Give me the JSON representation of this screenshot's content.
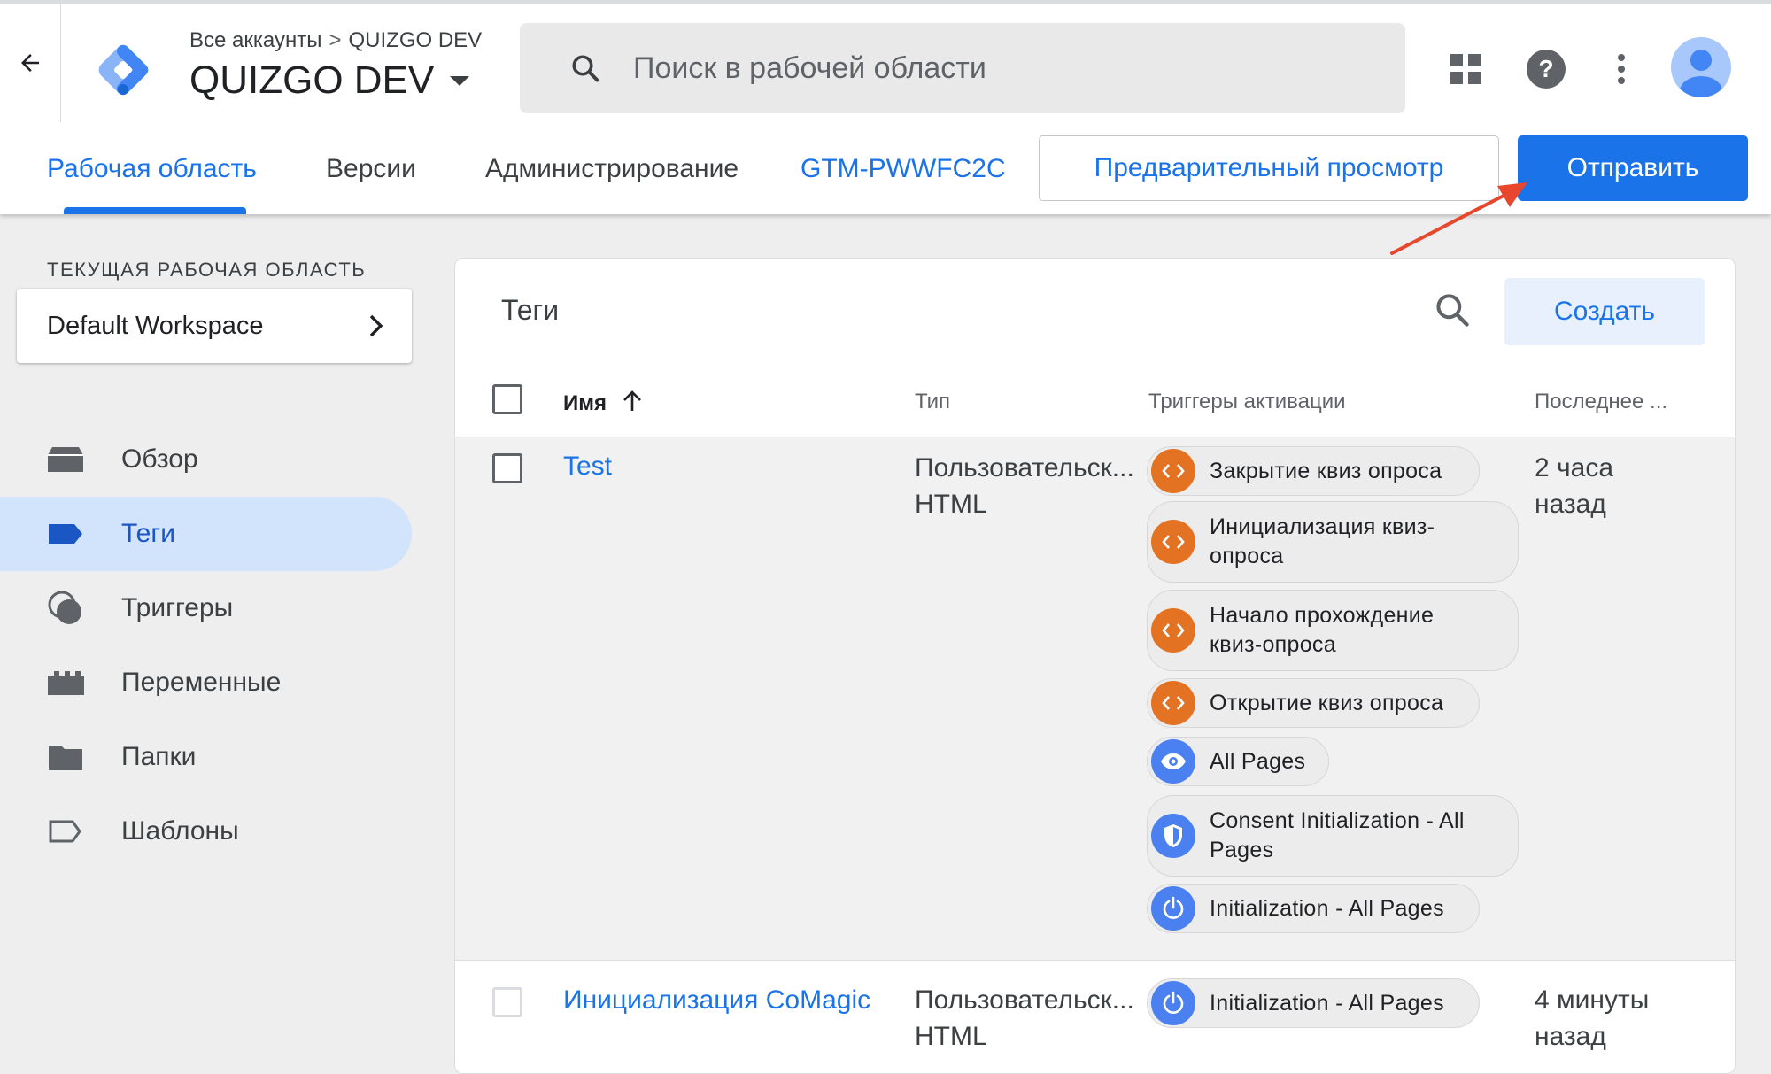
{
  "header": {
    "breadcrumb": {
      "accounts": "Все аккаунты",
      "container": "QUIZGO DEV"
    },
    "container_name": "QUIZGO DEV",
    "search_placeholder": "Поиск в рабочей области"
  },
  "nav": {
    "tabs": [
      {
        "label": "Рабочая область",
        "active": true
      },
      {
        "label": "Версии"
      },
      {
        "label": "Администрирование"
      }
    ],
    "container_id": "GTM-PWWFC2C",
    "preview_label": "Предварительный просмотр",
    "submit_label": "Отправить"
  },
  "sidebar": {
    "workspace_caption": "ТЕКУЩАЯ РАБОЧАЯ ОБЛАСТЬ",
    "workspace_name": "Default Workspace",
    "items": [
      {
        "label": "Обзор",
        "icon": "overview-icon"
      },
      {
        "label": "Теги",
        "icon": "tag-icon",
        "active": true
      },
      {
        "label": "Триггеры",
        "icon": "trigger-icon"
      },
      {
        "label": "Переменные",
        "icon": "variables-icon"
      },
      {
        "label": "Папки",
        "icon": "folder-icon"
      },
      {
        "label": "Шаблоны",
        "icon": "template-icon"
      }
    ]
  },
  "tags_panel": {
    "title": "Теги",
    "create_label": "Создать",
    "columns": {
      "name": "Имя",
      "type": "Тип",
      "triggers": "Триггеры активации",
      "last_edited": "Последнее ..."
    },
    "rows": [
      {
        "name": "Test",
        "type_line1": "Пользовательск...",
        "type_line2": "HTML",
        "triggers": [
          {
            "line1": "Закрытие квиз опроса",
            "icon": "code-icon"
          },
          {
            "line1": "Инициализация квиз-",
            "line2": "опроса",
            "icon": "code-icon"
          },
          {
            "line1": "Начало прохождение",
            "line2": "квиз-опроса",
            "icon": "code-icon"
          },
          {
            "line1": "Открытие квиз опроса",
            "icon": "code-icon"
          },
          {
            "line1": "All Pages",
            "icon": "eye-icon"
          },
          {
            "line1": "Consent Initialization - All",
            "line2": "Pages",
            "icon": "shield-icon"
          },
          {
            "line1": "Initialization - All Pages",
            "icon": "power-icon"
          }
        ],
        "edited_line1": "2 часа",
        "edited_line2": "назад"
      },
      {
        "name": "Инициализация CoMagic",
        "type_line1": "Пользовательск...",
        "type_line2": "HTML",
        "triggers": [
          {
            "line1": "Initialization - All Pages",
            "icon": "power-icon"
          }
        ],
        "edited_line1": "4 минуты",
        "edited_line2": "назад"
      }
    ]
  },
  "colors": {
    "accent": "#1a73e8",
    "active_nav_bg": "#d2e3fc",
    "custom_trigger": "#e37222",
    "builtin_trigger": "#4a80f0",
    "annotation_arrow": "#e8472e"
  }
}
